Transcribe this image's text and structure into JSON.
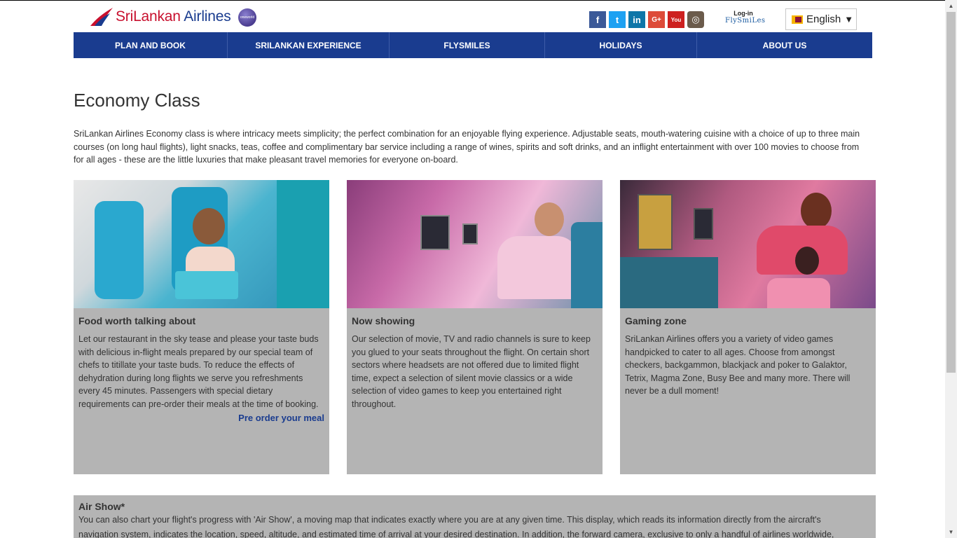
{
  "header": {
    "logo_text_main": "SriLankan",
    "logo_text_secondary": "Airlines",
    "oneworld_label": "oneworld",
    "social": [
      "f",
      "t",
      "in",
      "G+",
      "You",
      "◎"
    ],
    "login_line1": "Log-in",
    "login_line2": "FlySmiLes",
    "language": "English",
    "language_caret": "▼"
  },
  "nav": {
    "items": [
      {
        "label": "PLAN AND BOOK"
      },
      {
        "label": "SRILANKAN EXPERIENCE"
      },
      {
        "label": "FLYSMILES"
      },
      {
        "label": "HOLIDAYS"
      },
      {
        "label": "ABOUT US"
      }
    ]
  },
  "main": {
    "title": "Economy Class",
    "intro": "SriLankan Airlines Economy class is where intricacy meets simplicity; the perfect combination for an enjoyable flying experience. Adjustable seats, mouth-watering cuisine with a choice of up to three main courses (on long haul flights), light snacks, teas, coffee and complimentary bar service including a range of wines, spirits and soft drinks, and an inflight entertainment with over 100 movies to choose from for all ages - these are the little luxuries that make pleasant travel memories for everyone on-board.",
    "cards": [
      {
        "title": "Food worth talking about",
        "text": "Let our restaurant in the sky tease and please your taste buds with delicious in-flight meals prepared by our special team of chefs to titillate your taste buds. To reduce the effects of dehydration during long flights we serve you refreshments every 45 minutes. Passengers with special dietary requirements can pre-order their meals at the time of booking.",
        "link": "Pre order your meal"
      },
      {
        "title": "Now showing",
        "text": "Our selection of movie, TV and radio channels is sure to keep you glued to your seats throughout the flight. On certain short sectors where headsets are not offered due to limited flight time, expect a selection of silent movie classics or a wide selection of video games to keep you entertained right throughout."
      },
      {
        "title": "Gaming zone",
        "text": "SriLankan Airlines offers you a variety of video games handpicked to cater to all ages. Choose from amongst checkers, backgammon, blackjack and poker to Galaktor, Tetrix, Magma Zone, Busy Bee and many more. There will never be a dull moment!"
      }
    ],
    "airshow": {
      "title": "Air Show*",
      "line1": "You can also chart your flight's progress with 'Air Show', a moving map that indicates exactly where you are at any given time. This display, which reads its information directly from the aircraft's",
      "line2": "navigation system, indicates the location, speed, altitude, and estimated time of arrival at your desired destination. In addition, the forward camera, exclusive to only a handful of airlines worldwide,"
    }
  },
  "scrollbar": {
    "up": "▲",
    "down": "▼"
  }
}
